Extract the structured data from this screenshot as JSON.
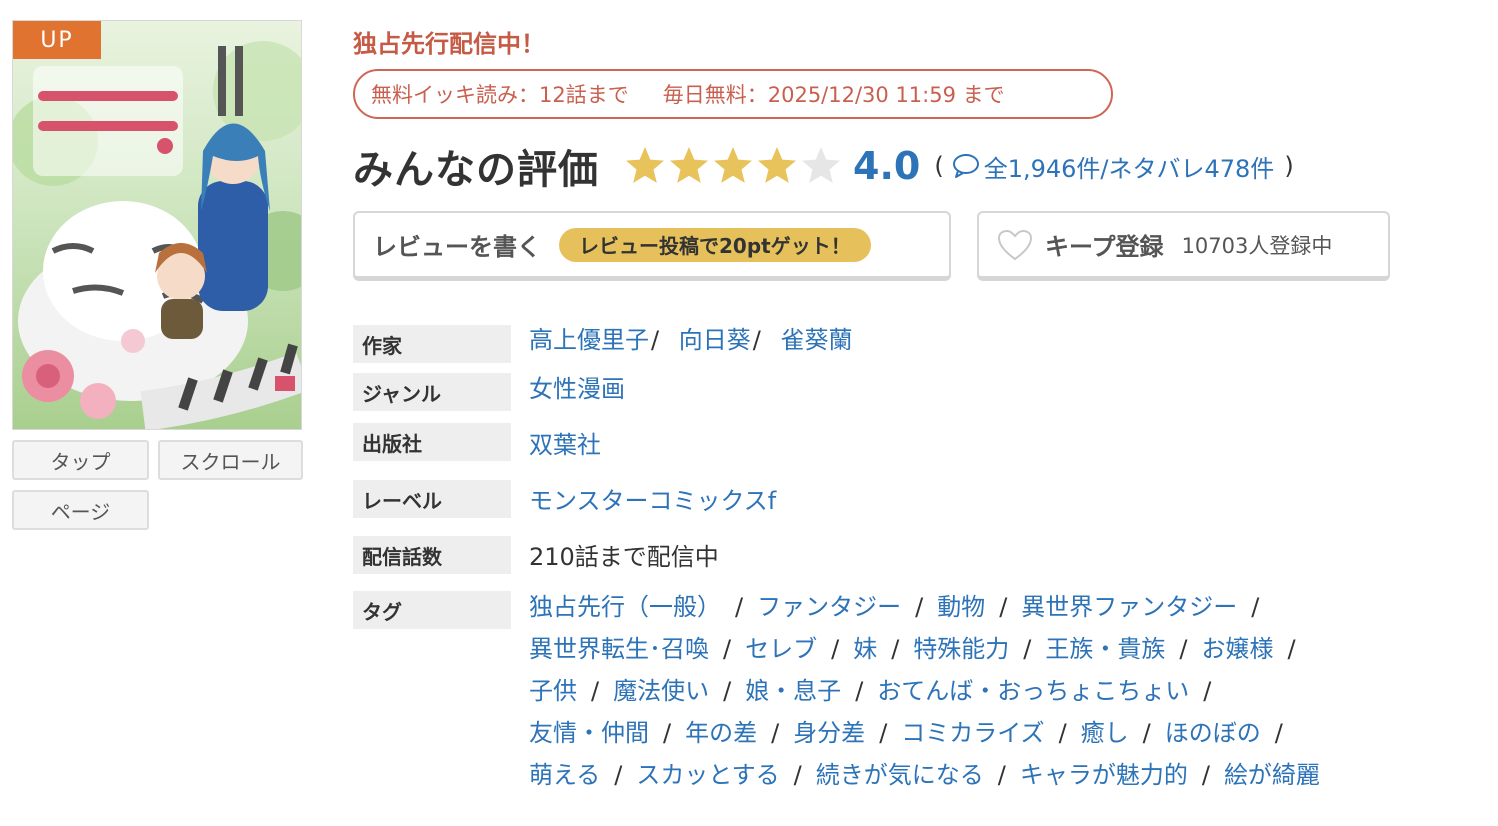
{
  "cover": {
    "badge": "UP"
  },
  "view_modes": [
    {
      "label": "タップ"
    },
    {
      "label": "スクロール"
    },
    {
      "label": "ページ"
    }
  ],
  "promo": {
    "title": "独占先行配信中！",
    "free_read": "無料イッキ読み：12話まで",
    "daily_free": "毎日無料：2025/12/30 11:59 まで"
  },
  "rating": {
    "heading": "みんなの評価",
    "stars_filled": 4,
    "stars_total": 5,
    "value": "4.0",
    "open_paren": "(",
    "close_paren": ")",
    "count_text": "全1,946件/ネタバレ478件",
    "star_color": "#e8c25a",
    "star_empty_color": "#e6e6e6"
  },
  "review": {
    "label": "レビューを書く",
    "bonus": "レビュー投稿で20ptゲット！"
  },
  "keep": {
    "label": "キープ登録",
    "count": "10703人登録中"
  },
  "info": {
    "author_label": "作家",
    "authors": [
      "高上優里子",
      "向日葵",
      "雀葵蘭"
    ],
    "author_sep": "/",
    "genre_label": "ジャンル",
    "genre": "女性漫画",
    "publisher_label": "出版社",
    "publisher": "双葉社",
    "label_label": "レーベル",
    "label": "モンスターコミックスf",
    "episodes_label": "配信話数",
    "episodes": "210話まで配信中",
    "tags_label": "タグ",
    "tag_sep": "/",
    "tags": [
      [
        "独占先行（一般）",
        "ファンタジー",
        "動物",
        "異世界ファンタジー"
      ],
      [
        "異世界転生･召喚",
        "セレブ",
        "妹",
        "特殊能力",
        "王族・貴族",
        "お嬢様"
      ],
      [
        "子供",
        "魔法使い",
        "娘・息子",
        "おてんば・おっちょこちょい"
      ],
      [
        "友情・仲間",
        "年の差",
        "身分差",
        "コミカライズ",
        "癒し",
        "ほのぼの"
      ],
      [
        "萌える",
        "スカッとする",
        "続きが気になる",
        "キャラが魅力的",
        "絵が綺麗"
      ]
    ]
  },
  "colors": {
    "link": "#2d73b8",
    "promo": "#c55a45",
    "badge": "#e07330",
    "bonus": "#e6c15b"
  }
}
